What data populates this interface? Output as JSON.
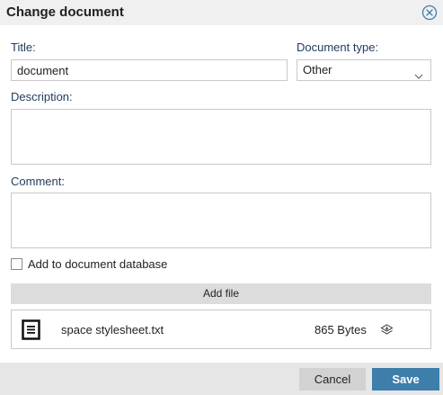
{
  "dialog": {
    "title": "Change document",
    "close_icon": "close-circle-icon"
  },
  "form": {
    "title_label": "Title:",
    "title_value": "document",
    "document_type_label": "Document type:",
    "document_type_value": "Other",
    "description_label": "Description:",
    "description_value": "",
    "comment_label": "Comment:",
    "comment_value": "",
    "add_to_db_label": "Add to document database",
    "add_to_db_checked": false
  },
  "files": {
    "add_file_label": "Add file",
    "items": [
      {
        "icon": "document-icon",
        "name": "space stylesheet.txt",
        "size": "865 Bytes",
        "action_icon": "download-icon"
      }
    ]
  },
  "footer": {
    "cancel_label": "Cancel",
    "save_label": "Save"
  },
  "colors": {
    "accent": "#3d7eaa",
    "label": "#1f3a5c",
    "title_bar": "#f0f0f0",
    "footer": "#e6e6e6"
  }
}
